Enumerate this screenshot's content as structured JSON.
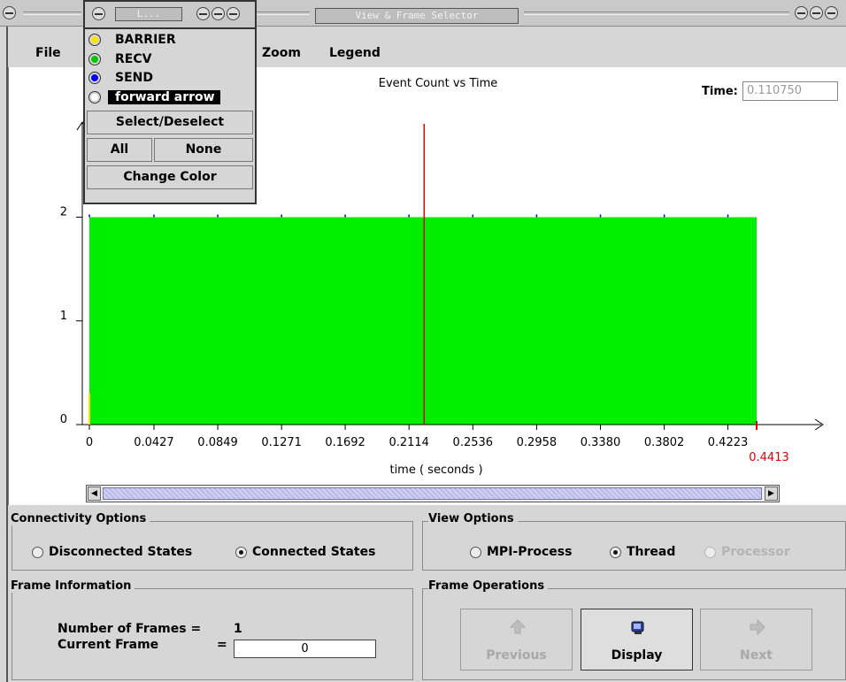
{
  "window": {
    "title": "View & Frame Selector",
    "popup_title": "L..."
  },
  "menu": [
    "File",
    "Zoom",
    "Legend"
  ],
  "legend_popup": {
    "items": [
      {
        "label": "BARRIER",
        "color": "#f5e400",
        "selected": false
      },
      {
        "label": "RECV",
        "color": "#00c800",
        "selected": false
      },
      {
        "label": "SEND",
        "color": "#0000ff",
        "selected": false
      },
      {
        "label": "forward arrow",
        "color": "#ffffff",
        "selected": true
      }
    ],
    "select_deselect": "Select/Deselect",
    "all": "All",
    "none": "None",
    "change_color": "Change Color"
  },
  "time": {
    "label": "Time:",
    "value": "0.110750"
  },
  "chart_data": {
    "type": "area",
    "title": "Event Count vs Time",
    "xlabel": "time ( seconds )",
    "ylabel": "",
    "xlim": [
      0,
      0.4413
    ],
    "ylim": [
      0,
      2.9
    ],
    "x_ticks": [
      "0",
      "0.0427",
      "0.0849",
      "0.1271",
      "0.1692",
      "0.2114",
      "0.2536",
      "0.2958",
      "0.3380",
      "0.3802",
      "0.4223"
    ],
    "y_ticks": [
      0,
      1,
      2
    ],
    "end_marker": "0.4413",
    "cursor_time": 0.2214,
    "series": [
      {
        "name": "RECV",
        "color": "#00ee00",
        "x": [
          0,
          0.4413
        ],
        "y": [
          2,
          2
        ]
      }
    ]
  },
  "connectivity": {
    "title": "Connectivity Options",
    "options": [
      "Disconnected States",
      "Connected States"
    ],
    "selected": 1
  },
  "view": {
    "title": "View Options",
    "options": [
      "MPI-Process",
      "Thread",
      "Processor"
    ],
    "selected": 1,
    "disabled": [
      2
    ]
  },
  "frame_info": {
    "title": "Frame Information",
    "num_frames_label": "Number of Frames =",
    "num_frames": "1",
    "current_label": "Current Frame",
    "current_eq": "=",
    "current_value": "0"
  },
  "frame_ops": {
    "title": "Frame Operations",
    "previous": "Previous",
    "display": "Display",
    "next": "Next"
  }
}
